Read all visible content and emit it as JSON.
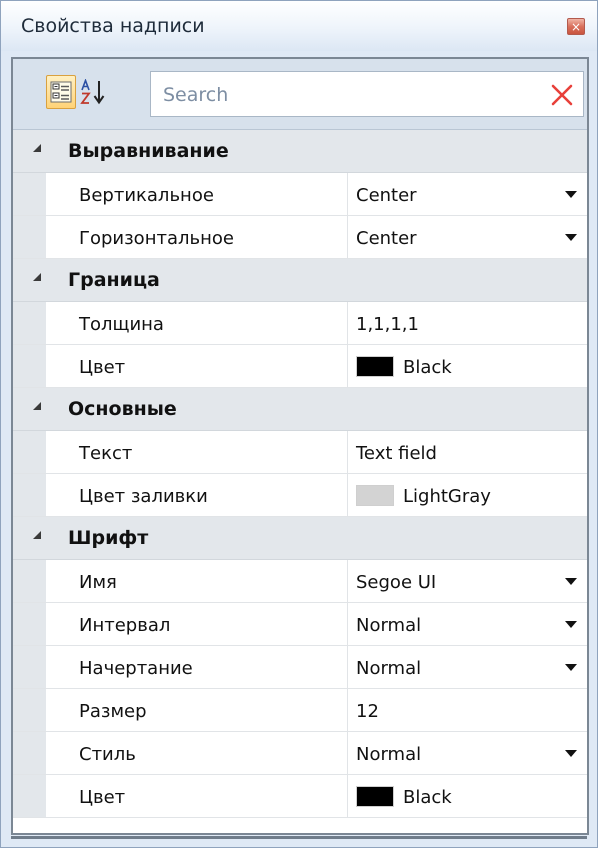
{
  "window": {
    "title": "Свойства надписи",
    "close_glyph": "×"
  },
  "toolbar": {
    "categorized_icon": "categorized-icon",
    "alphabetical_icon": "sort-az-icon",
    "search_placeholder": "Search",
    "clear_icon": "clear-x-icon",
    "clear_color": "#e8403a"
  },
  "categories": [
    {
      "label": "Выравнивание",
      "props": [
        {
          "name": "Вертикальное",
          "value": "Center",
          "dropdown": true
        },
        {
          "name": "Горизонтальное",
          "value": "Center",
          "dropdown": true
        }
      ]
    },
    {
      "label": "Граница",
      "props": [
        {
          "name": "Толщина",
          "value": "1,1,1,1",
          "dropdown": false
        },
        {
          "name": "Цвет",
          "value": "Black",
          "swatch": "#000000",
          "dropdown": false
        }
      ]
    },
    {
      "label": "Основные",
      "props": [
        {
          "name": "Текст",
          "value": "Text field",
          "dropdown": false
        },
        {
          "name": "Цвет заливки",
          "value": "LightGray",
          "swatch": "#d3d3d3",
          "dropdown": false
        }
      ]
    },
    {
      "label": "Шрифт",
      "props": [
        {
          "name": "Имя",
          "value": "Segoe UI",
          "dropdown": true
        },
        {
          "name": "Интервал",
          "value": "Normal",
          "dropdown": true
        },
        {
          "name": "Начертание",
          "value": "Normal",
          "dropdown": true
        },
        {
          "name": "Размер",
          "value": "12",
          "dropdown": false
        },
        {
          "name": "Стиль",
          "value": "Normal",
          "dropdown": true
        },
        {
          "name": "Цвет",
          "value": "Black",
          "swatch": "#000000",
          "dropdown": false
        }
      ]
    }
  ]
}
